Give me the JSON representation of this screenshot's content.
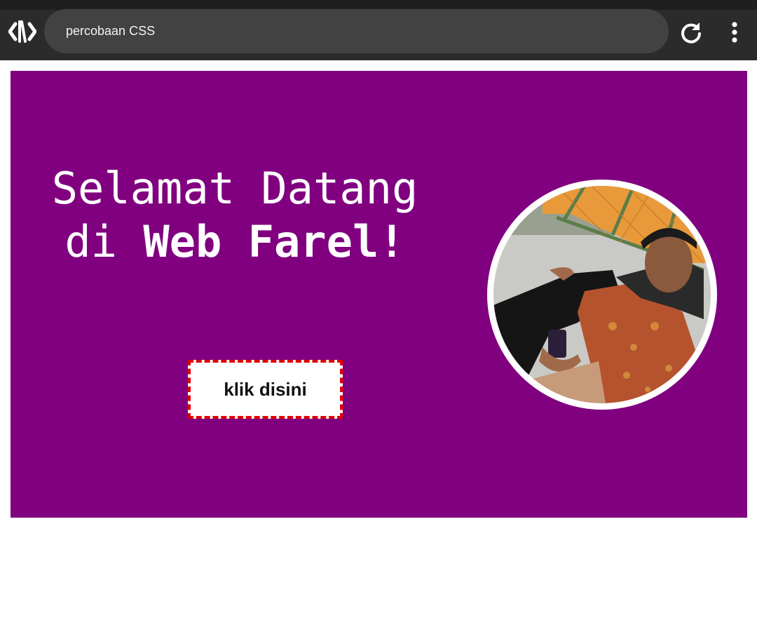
{
  "browser": {
    "address_text": "percobaan CSS",
    "icons": {
      "logo": "code-logo-icon",
      "reload": "reload-icon",
      "menu": "more-vertical-icon"
    }
  },
  "hero": {
    "title_line1": "Selamat Datang",
    "title_line2_prefix": "di",
    "title_line2_bold": "Web Farel!",
    "button_label": "klik disini",
    "background_color": "#800080",
    "button_border_color": "#e00000"
  }
}
